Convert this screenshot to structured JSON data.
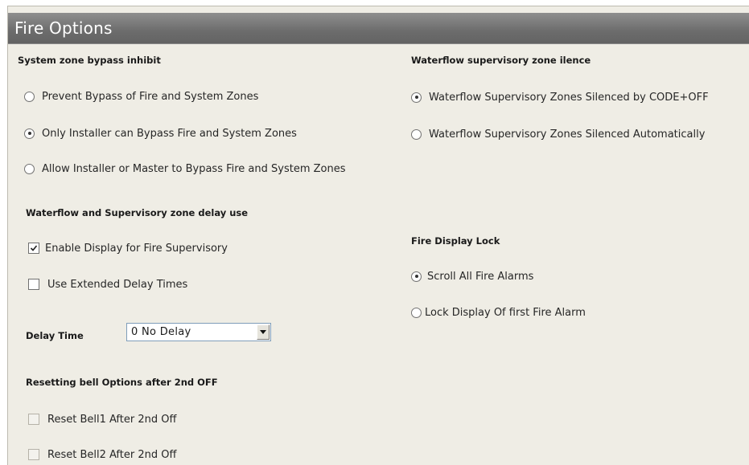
{
  "panel": {
    "title": "Fire Options"
  },
  "bypass": {
    "heading": "System zone bypass inhibit",
    "options": [
      {
        "label": "Prevent Bypass of Fire and System Zones",
        "selected": false
      },
      {
        "label": "Only Installer can Bypass Fire and System Zones",
        "selected": true
      },
      {
        "label": "Allow Installer or Master to Bypass Fire and System Zones",
        "selected": false
      }
    ]
  },
  "waterflow_silence": {
    "heading": "Waterflow supervisory zone ilence",
    "options": [
      {
        "label": "Waterflow Supervisory Zones Silenced by CODE+OFF",
        "selected": true
      },
      {
        "label": "Waterflow Supervisory Zones Silenced Automatically",
        "selected": false
      }
    ]
  },
  "delay_use": {
    "heading": "Waterflow and Supervisory zone delay use",
    "checkboxes": [
      {
        "label": "Enable Display for Fire Supervisory",
        "checked": true
      },
      {
        "label": "Use Extended Delay Times",
        "checked": false
      }
    ]
  },
  "delay_time": {
    "label": "Delay Time",
    "selected_value": "0 No Delay"
  },
  "fire_display_lock": {
    "heading": "Fire Display Lock",
    "options": [
      {
        "label": "Scroll All Fire Alarms",
        "selected": true
      },
      {
        "label": "Lock Display Of first Fire Alarm",
        "selected": false
      }
    ]
  },
  "bell_reset": {
    "heading": "Resetting bell Options after 2nd OFF",
    "checkboxes": [
      {
        "label": "Reset Bell1 After 2nd Off",
        "checked": false,
        "disabled": true
      },
      {
        "label": "Reset Bell2 After 2nd Off",
        "checked": false,
        "disabled": true
      }
    ]
  },
  "icons": {
    "radio": "radio-button-icon",
    "checkbox": "checkbox-icon",
    "check": "check-mark-icon",
    "dropdown": "chevron-down-icon"
  },
  "colors": {
    "title_bar": "#6e6e6e",
    "panel_background": "#efede5",
    "title_text": "#ffffff"
  }
}
